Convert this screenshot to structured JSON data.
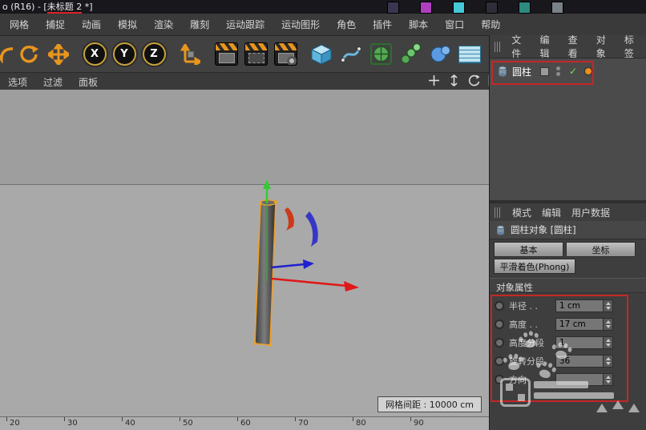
{
  "window": {
    "title_prefix": "o (R16) - [",
    "title_doc": "未标题 2",
    "title_suffix": " *]",
    "thumbnails": [
      "#3a3550",
      "#b03fc0",
      "#45c8d8",
      "#2e2e38",
      "#2e8a80",
      "#7a8088"
    ]
  },
  "menu_bar": {
    "items": [
      "网格",
      "捕捉",
      "动画",
      "模拟",
      "渲染",
      "雕刻",
      "运动跟踪",
      "运动图形",
      "角色",
      "插件",
      "脚本",
      "窗口",
      "帮助"
    ]
  },
  "toolbar": {
    "axis_locks": [
      "X",
      "Y",
      "Z"
    ],
    "icons": [
      "undo-icon",
      "redo-icon",
      "move-tool-icon",
      "x-axis-lock",
      "y-axis-lock",
      "z-axis-lock",
      "coordinate-system-icon",
      "render-view-icon",
      "render-region-icon",
      "render-settings-icon",
      "primitive-cube-icon",
      "spline-pen-icon",
      "subdivision-surface-icon",
      "cloner-icon",
      "metaball-icon",
      "array-grid-icon"
    ],
    "accent_orange": "#e8951e"
  },
  "viewport": {
    "menus": [
      "选项",
      "过滤",
      "面板"
    ],
    "nav_icons": [
      "pan-icon",
      "zoom-icon",
      "rotate-icon",
      "toggle-view-icon"
    ],
    "grid_label": "网格间距 : 10000 cm",
    "ruler_ticks": [
      "20",
      "30",
      "40",
      "50",
      "60",
      "70",
      "80",
      "90"
    ],
    "selection_color": "#f0a028"
  },
  "object_manager": {
    "menus": [
      "文件",
      "编辑",
      "查看",
      "对象",
      "标签"
    ],
    "object_name": "圆柱",
    "enabled_glyph": "✓"
  },
  "attribute_manager": {
    "menus": [
      "模式",
      "编辑",
      "用户数据"
    ],
    "header_title": "圆柱对象 [圆柱]",
    "tabs": [
      "基本",
      "坐标"
    ],
    "tab_phong": "平滑着色(Phong)",
    "section_title": "对象属性",
    "properties": [
      {
        "label": "半径 . .",
        "value": "1 cm"
      },
      {
        "label": "高度 . .",
        "value": "17 cm"
      },
      {
        "label": "高度分段",
        "value": "1"
      },
      {
        "label": "旋转分段",
        "value": "36"
      },
      {
        "label": "方向",
        "value": ""
      }
    ]
  },
  "colors": {
    "annotation_red": "#c62626",
    "ui_dark": "#3c3c3c",
    "viewport_gray": "#a4a4a4"
  }
}
